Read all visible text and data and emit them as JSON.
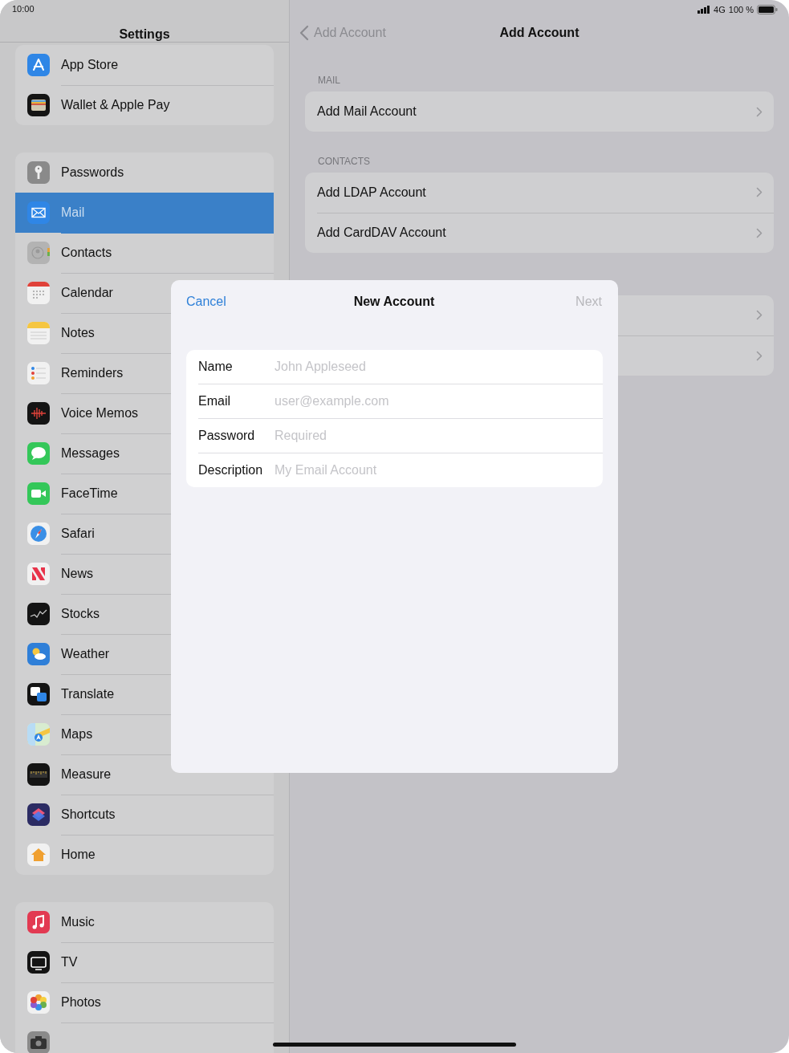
{
  "status_bar": {
    "time": "10:00",
    "network": "4G",
    "battery": "100 %"
  },
  "sidebar": {
    "title": "Settings",
    "groups": [
      {
        "items": [
          {
            "label": "App Store",
            "kind": "appstore",
            "selected": false
          },
          {
            "label": "Wallet & Apple Pay",
            "kind": "wallet",
            "selected": false
          }
        ]
      },
      {
        "items": [
          {
            "label": "Passwords",
            "kind": "passwords",
            "selected": false
          },
          {
            "label": "Mail",
            "kind": "mail",
            "selected": true
          },
          {
            "label": "Contacts",
            "kind": "contacts",
            "selected": false
          },
          {
            "label": "Calendar",
            "kind": "calendar",
            "selected": false
          },
          {
            "label": "Notes",
            "kind": "notes",
            "selected": false
          },
          {
            "label": "Reminders",
            "kind": "reminders",
            "selected": false
          },
          {
            "label": "Voice Memos",
            "kind": "voicememos",
            "selected": false
          },
          {
            "label": "Messages",
            "kind": "messages",
            "selected": false
          },
          {
            "label": "FaceTime",
            "kind": "facetime",
            "selected": false
          },
          {
            "label": "Safari",
            "kind": "safari",
            "selected": false
          },
          {
            "label": "News",
            "kind": "news",
            "selected": false
          },
          {
            "label": "Stocks",
            "kind": "stocks",
            "selected": false
          },
          {
            "label": "Weather",
            "kind": "weather",
            "selected": false
          },
          {
            "label": "Translate",
            "kind": "translate",
            "selected": false
          },
          {
            "label": "Maps",
            "kind": "maps",
            "selected": false
          },
          {
            "label": "Measure",
            "kind": "measure",
            "selected": false
          },
          {
            "label": "Shortcuts",
            "kind": "shortcuts",
            "selected": false
          },
          {
            "label": "Home",
            "kind": "home",
            "selected": false
          }
        ]
      },
      {
        "items": [
          {
            "label": "Music",
            "kind": "music",
            "selected": false
          },
          {
            "label": "TV",
            "kind": "tv",
            "selected": false
          },
          {
            "label": "Photos",
            "kind": "photos",
            "selected": false
          },
          {
            "kind": "camera",
            "selected": false
          }
        ]
      }
    ]
  },
  "detail": {
    "back": "Add Account",
    "title": "Add Account",
    "sections": [
      {
        "header": "MAIL",
        "rows": [
          {
            "kind": "link",
            "label": "Add Mail Account"
          }
        ]
      },
      {
        "header": "CONTACTS",
        "rows": [
          {
            "kind": "link",
            "label": "Add LDAP Account"
          },
          {
            "kind": "link",
            "label": "Add CardDAV Account"
          }
        ]
      },
      {
        "rows": [
          {
            "kind": "link"
          },
          {
            "kind": "link"
          }
        ]
      }
    ]
  },
  "modal": {
    "cancel": "Cancel",
    "title": "New Account",
    "next": {
      "label": "Next",
      "disabled": true
    },
    "fields": [
      {
        "label": "Name",
        "placeholder": "John Appleseed"
      },
      {
        "label": "Email",
        "placeholder": "user@example.com"
      },
      {
        "label": "Password",
        "placeholder": "Required"
      },
      {
        "label": "Description",
        "placeholder": "My Email Account"
      }
    ]
  }
}
